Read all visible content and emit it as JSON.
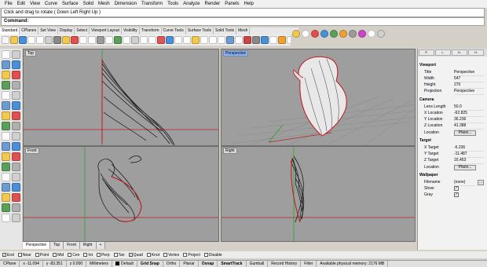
{
  "menu": [
    "File",
    "Edit",
    "View",
    "Curve",
    "Surface",
    "Solid",
    "Mesh",
    "Dimension",
    "Transform",
    "Tools",
    "Analyze",
    "Render",
    "Panels",
    "Help"
  ],
  "command": {
    "history": "Click and drag to rotate ( Down  Left  Right  Up )",
    "prompt": "Command:"
  },
  "toolbar_tabs": [
    "Standard",
    "CPlanes",
    "Set View",
    "Display",
    "Select",
    "Viewport Layout",
    "Visibility",
    "Transform",
    "Curve Tools",
    "Surface Tools",
    "Solid Tools",
    "Mesh"
  ],
  "viewports": {
    "top": "Top",
    "perspective": "Perspective",
    "front": "Front",
    "right": "Right"
  },
  "viewport_tabs": [
    "Perspective",
    "Top",
    "Front",
    "Right"
  ],
  "viewport_tab_add": "+",
  "panel": {
    "tabs": [
      "P.",
      "L.",
      "D.",
      "H."
    ],
    "viewport_section": "Viewport",
    "title_label": "Title",
    "title_value": "Perspective",
    "width_label": "Width",
    "width_value": "547",
    "height_label": "Height",
    "height_value": "270",
    "projection_label": "Projection",
    "projection_value": "Perspective",
    "camera_section": "Camera",
    "lens_label": "Lens Length",
    "lens_value": "50.0",
    "xloc_label": "X Location",
    "xloc_value": "-62.825",
    "yloc_label": "Y Location",
    "yloc_value": "36.236",
    "zloc_label": "Z Location",
    "zloc_value": "41.388",
    "location_label": "Location",
    "place_button": "Place...",
    "target_section": "Target",
    "xtgt_label": "X Target",
    "xtgt_value": "-6.236",
    "ytgt_label": "Y Target",
    "ytgt_value": "-11.487",
    "ztgt_label": "Z Target",
    "ztgt_value": "16.453",
    "wallpaper_section": "Wallpaper",
    "filename_label": "Filename",
    "filename_value": "(none)",
    "show_label": "Show",
    "gray_label": "Gray"
  },
  "osnaps": [
    {
      "label": "End",
      "checked": true
    },
    {
      "label": "Near",
      "checked": false
    },
    {
      "label": "Point",
      "checked": false
    },
    {
      "label": "Mid",
      "checked": false
    },
    {
      "label": "Cen",
      "checked": false
    },
    {
      "label": "Int",
      "checked": false
    },
    {
      "label": "Perp",
      "checked": false
    },
    {
      "label": "Tan",
      "checked": false
    },
    {
      "label": "Quad",
      "checked": true
    },
    {
      "label": "Knot",
      "checked": false
    },
    {
      "label": "Vertex",
      "checked": false
    },
    {
      "label": "Project",
      "checked": false
    },
    {
      "label": "Disable",
      "checked": false
    }
  ],
  "status": {
    "cplane": "CPlane",
    "x": "x -11.094",
    "y": "y -83.351",
    "z": "z 0.000",
    "units": "Millimeters",
    "layer": "Default",
    "grid_snap": "Grid Snap",
    "ortho": "Ortho",
    "planar": "Planar",
    "osnap": "Osnap",
    "smarttrack": "SmartTrack",
    "gumball": "Gumball",
    "record_history": "Record History",
    "filter": "Filter",
    "memory": "Available physical memory: 2176 MB"
  },
  "colors": {
    "viewport_bg": "#9e9e9e",
    "active_label": "#7fb2ff",
    "curve": "#111111",
    "edge_red": "#c0161a",
    "axis_green": "#2aa32a",
    "axis_red": "#b22222"
  }
}
